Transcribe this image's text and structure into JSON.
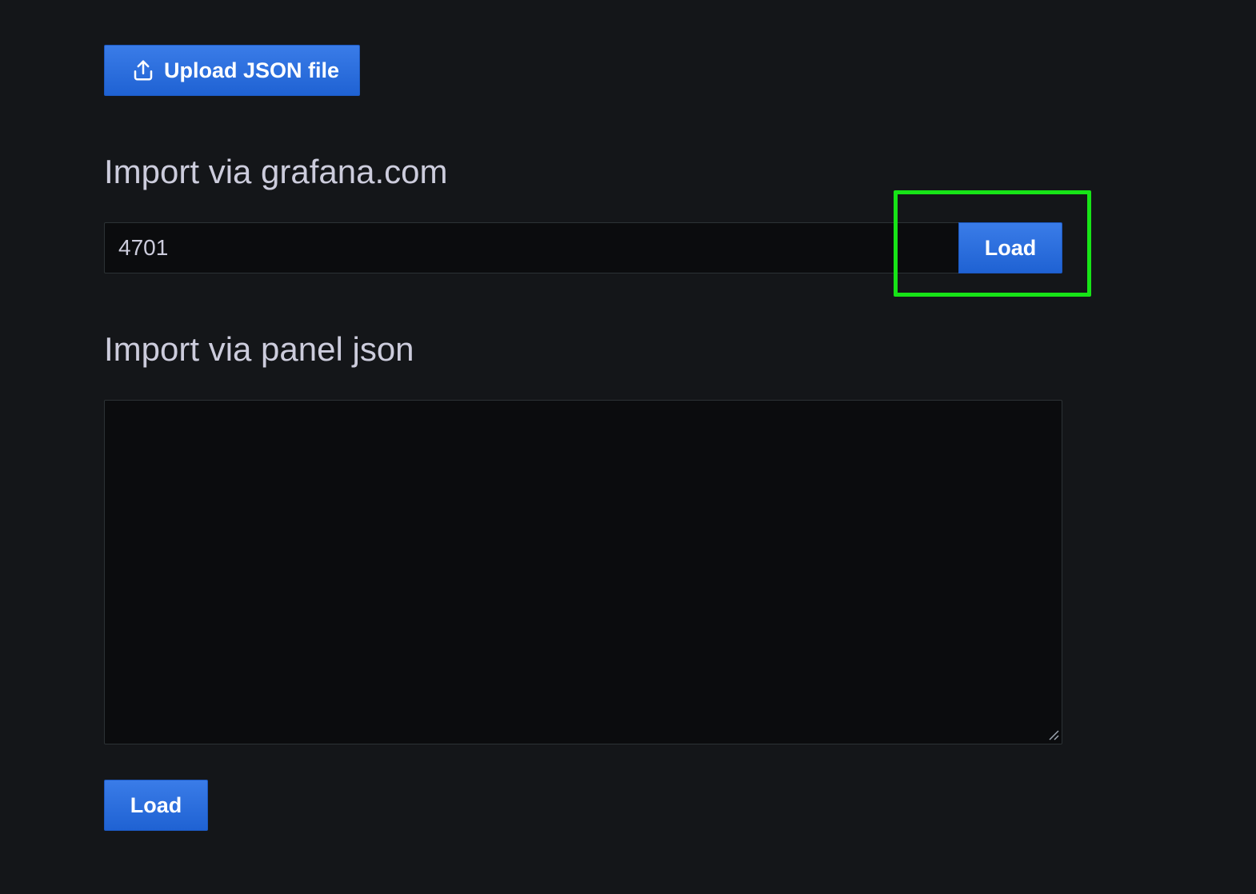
{
  "upload": {
    "label": "Upload JSON file",
    "icon": "upload-icon"
  },
  "grafana_import": {
    "title": "Import via grafana.com",
    "input_value": "4701",
    "load_label": "Load"
  },
  "panel_json_import": {
    "title": "Import via panel json",
    "textarea_value": "",
    "load_label": "Load"
  },
  "colors": {
    "background": "#141619",
    "primary_button": "#1f62d3",
    "highlight": "#17e417",
    "input_background": "#0b0c0e",
    "text": "#ccccdc"
  }
}
